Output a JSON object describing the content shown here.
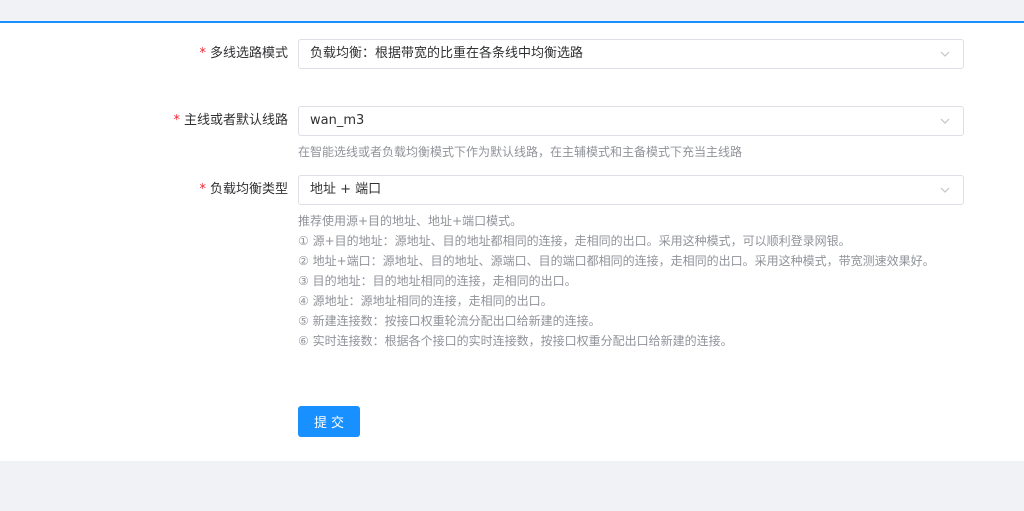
{
  "form": {
    "multiline_mode": {
      "required_mark": "*",
      "label": "多线选路模式",
      "value": "负载均衡：根据带宽的比重在各条线中均衡选路"
    },
    "default_line": {
      "required_mark": "*",
      "label": "主线或者默认线路",
      "value": "wan_m3",
      "hint": "在智能选线或者负载均衡模式下作为默认线路，在主辅模式和主备模式下充当主线路"
    },
    "balance_type": {
      "required_mark": "*",
      "label": "负载均衡类型",
      "value": "地址 + 端口",
      "hints": [
        "推荐使用源+目的地址、地址+端口模式。",
        "① 源+目的地址：源地址、目的地址都相同的连接，走相同的出口。采用这种模式，可以顺利登录网银。",
        "② 地址+端口：源地址、目的地址、源端口、目的端口都相同的连接，走相同的出口。采用这种模式，带宽测速效果好。",
        "③ 目的地址：目的地址相同的连接，走相同的出口。",
        "④ 源地址：源地址相同的连接，走相同的出口。",
        "⑤ 新建连接数：按接口权重轮流分配出口给新建的连接。",
        "⑥ 实时连接数：根据各个接口的实时连接数，按接口权重分配出口给新建的连接。"
      ]
    },
    "submit_label": "提交"
  },
  "icons": {
    "dropdown": "chevron-down-icon"
  },
  "colors": {
    "accent": "#1890ff",
    "required": "#f5222d",
    "page_bg": "#f0f2f5",
    "panel_bg": "#ffffff"
  }
}
